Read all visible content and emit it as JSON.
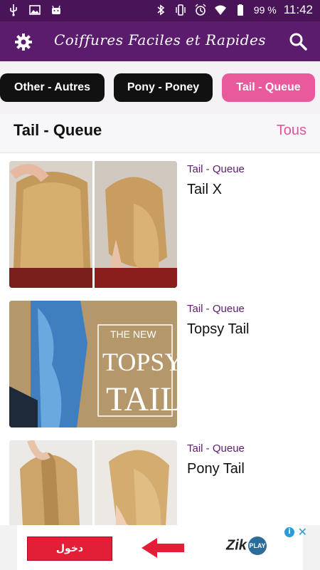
{
  "status_bar": {
    "time": "11:42",
    "battery_percent": "99 %",
    "icons": [
      "usb-icon",
      "image-icon",
      "android-icon",
      "bluetooth-icon",
      "vibrate-icon",
      "alarm-icon",
      "wifi-icon",
      "battery-icon"
    ]
  },
  "app_bar": {
    "title": "Coiffures Faciles et Rapides",
    "left_icon": "gear-icon",
    "right_icon": "search-icon",
    "color": "#5b1c6e"
  },
  "categories": [
    {
      "label": "Other - Autres",
      "active": false
    },
    {
      "label": "Pony - Poney",
      "active": false
    },
    {
      "label": "Tail - Queue",
      "active": true
    }
  ],
  "section": {
    "title": "Tail - Queue",
    "link": "Tous"
  },
  "items": [
    {
      "category": "Tail - Queue",
      "title": "Tail X"
    },
    {
      "category": "Tail - Queue",
      "title": "Topsy Tail",
      "image_text": "THE NEW TOPSY TAIL"
    },
    {
      "category": "Tail - Queue",
      "title": "Pony Tail"
    }
  ],
  "ad": {
    "button_label": "دخول",
    "brand": "Zik",
    "badge": "PLAY",
    "info_icon": "info-icon",
    "close_icon": "close-icon"
  },
  "colors": {
    "accent_pink": "#e95a9c",
    "primary_purple": "#5b1c6e",
    "chip_dark": "#111111"
  }
}
